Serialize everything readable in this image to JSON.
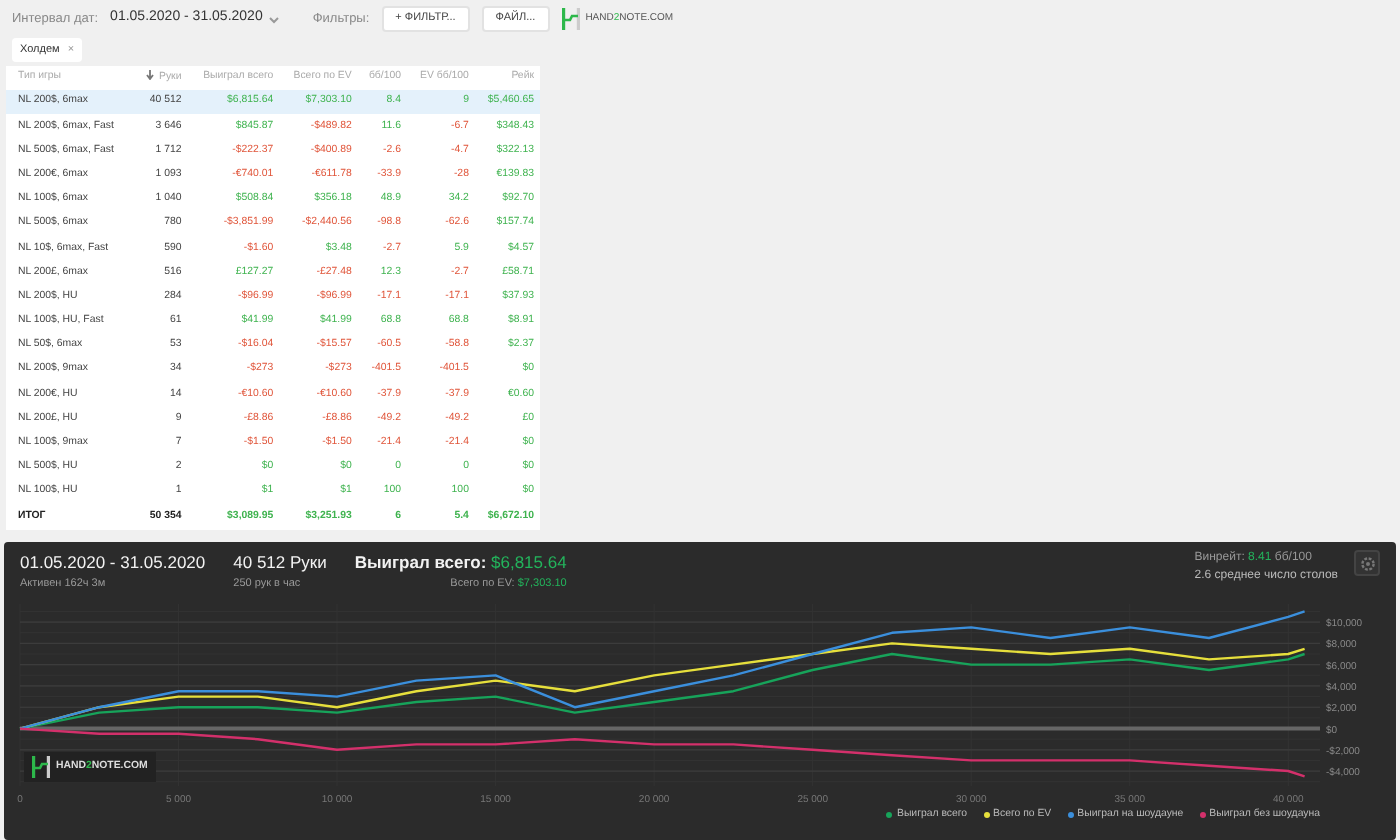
{
  "toolbar": {
    "date_label": "Интервал дат:",
    "date_value": "01.05.2020 - 31.05.2020",
    "filters_label": "Фильтры:",
    "filter_button": "+ ФИЛЬТР...",
    "file_button": "ФАЙЛ...",
    "logo": {
      "text_1": "HAND",
      "accent": "2",
      "text_2": "NOTE.COM"
    }
  },
  "chips": [
    {
      "label": "Холдем",
      "close": "×"
    }
  ],
  "table": {
    "columns": [
      {
        "label": "Тип игры",
        "sorted": false
      },
      {
        "label": "Руки",
        "sorted": true
      },
      {
        "label": "Выиграл всего",
        "sorted": false
      },
      {
        "label": "Всего по EV",
        "sorted": false
      },
      {
        "label": "бб/100",
        "sorted": false
      },
      {
        "label": "EV бб/100",
        "sorted": false
      },
      {
        "label": "Рейк",
        "sorted": false
      }
    ],
    "rows": [
      {
        "game": "NL 200$, 6max",
        "hands": "40 512",
        "values": [
          "$6,815.64",
          "$7,303.10",
          "8.4",
          "9",
          "$5,460.65"
        ],
        "loss": [
          false,
          false,
          false,
          false,
          false
        ],
        "selected": true
      },
      {
        "game": "NL 200$, 6max, Fast",
        "hands": "3 646",
        "values": [
          "$845.87",
          "-$489.82",
          "11.6",
          "-6.7",
          "$348.43"
        ],
        "loss": [
          false,
          true,
          false,
          true,
          false
        ],
        "selected": false
      },
      {
        "game": "NL 500$, 6max, Fast",
        "hands": "1 712",
        "values": [
          "-$222.37",
          "-$400.89",
          "-2.6",
          "-4.7",
          "$322.13"
        ],
        "loss": [
          true,
          true,
          true,
          true,
          false
        ],
        "selected": false
      },
      {
        "game": "NL 200€, 6max",
        "hands": "1 093",
        "values": [
          "-€740.01",
          "-€611.78",
          "-33.9",
          "-28",
          "€139.83"
        ],
        "loss": [
          true,
          true,
          true,
          true,
          false
        ],
        "selected": false
      },
      {
        "game": "NL 100$, 6max",
        "hands": "1 040",
        "values": [
          "$508.84",
          "$356.18",
          "48.9",
          "34.2",
          "$92.70"
        ],
        "loss": [
          false,
          false,
          false,
          false,
          false
        ],
        "selected": false
      },
      {
        "game": "NL 500$, 6max",
        "hands": "780",
        "values": [
          "-$3,851.99",
          "-$2,440.56",
          "-98.8",
          "-62.6",
          "$157.74"
        ],
        "loss": [
          true,
          true,
          true,
          true,
          false
        ],
        "selected": false
      },
      {
        "game": "NL 10$, 6max, Fast",
        "hands": "590",
        "values": [
          "-$1.60",
          "$3.48",
          "-2.7",
          "5.9",
          "$4.57"
        ],
        "loss": [
          true,
          false,
          true,
          false,
          false
        ],
        "selected": false
      },
      {
        "game": "NL 200£, 6max",
        "hands": "516",
        "values": [
          "£127.27",
          "-£27.48",
          "12.3",
          "-2.7",
          "£58.71"
        ],
        "loss": [
          false,
          true,
          false,
          true,
          false
        ],
        "selected": false
      },
      {
        "game": "NL 200$, HU",
        "hands": "284",
        "values": [
          "-$96.99",
          "-$96.99",
          "-17.1",
          "-17.1",
          "$37.93"
        ],
        "loss": [
          true,
          true,
          true,
          true,
          false
        ],
        "selected": false
      },
      {
        "game": "NL 100$, HU, Fast",
        "hands": "61",
        "values": [
          "$41.99",
          "$41.99",
          "68.8",
          "68.8",
          "$8.91"
        ],
        "loss": [
          false,
          false,
          false,
          false,
          false
        ],
        "selected": false
      },
      {
        "game": "NL 50$, 6max",
        "hands": "53",
        "values": [
          "-$16.04",
          "-$15.57",
          "-60.5",
          "-58.8",
          "$2.37"
        ],
        "loss": [
          true,
          true,
          true,
          true,
          false
        ],
        "selected": false
      },
      {
        "game": "NL 200$, 9max",
        "hands": "34",
        "values": [
          "-$273",
          "-$273",
          "-401.5",
          "-401.5",
          "$0"
        ],
        "loss": [
          true,
          true,
          true,
          true,
          false
        ],
        "selected": false
      },
      {
        "game": "NL 200€, HU",
        "hands": "14",
        "values": [
          "-€10.60",
          "-€10.60",
          "-37.9",
          "-37.9",
          "€0.60"
        ],
        "loss": [
          true,
          true,
          true,
          true,
          false
        ],
        "selected": false
      },
      {
        "game": "NL 200£, HU",
        "hands": "9",
        "values": [
          "-£8.86",
          "-£8.86",
          "-49.2",
          "-49.2",
          "£0"
        ],
        "loss": [
          true,
          true,
          true,
          true,
          false
        ],
        "selected": false
      },
      {
        "game": "NL 100$, 9max",
        "hands": "7",
        "values": [
          "-$1.50",
          "-$1.50",
          "-21.4",
          "-21.4",
          "$0"
        ],
        "loss": [
          true,
          true,
          true,
          true,
          false
        ],
        "selected": false
      },
      {
        "game": "NL 500$, HU",
        "hands": "2",
        "values": [
          "$0",
          "$0",
          "0",
          "0",
          "$0"
        ],
        "loss": [
          false,
          false,
          false,
          false,
          false
        ],
        "selected": false
      },
      {
        "game": "NL 100$, HU",
        "hands": "1",
        "values": [
          "$1",
          "$1",
          "100",
          "100",
          "$0"
        ],
        "loss": [
          false,
          false,
          false,
          false,
          false
        ],
        "selected": false
      }
    ],
    "total": {
      "game": "ИТОГ",
      "hands": "50 354",
      "values": [
        "$3,089.95",
        "$3,251.93",
        "6",
        "5.4",
        "$6,672.10"
      ],
      "loss": [
        false,
        false,
        false,
        false,
        false
      ]
    }
  },
  "graph_panel": {
    "period": "01.05.2020 - 31.05.2020",
    "active": "Активен 162ч 3м",
    "hands": "40 512 Руки",
    "hands_rate": "250 рук в час",
    "won_label": "Выиграл всего:",
    "won_value": "$6,815.64",
    "ev_label": "Всего по EV:",
    "ev_value": "$7,303.10",
    "winrate_label": "Винрейт:",
    "winrate_value": "8.41",
    "winrate_unit": "бб/100",
    "tables": "2.6 среднее число столов",
    "chart_logo": {
      "text_1": "HAND",
      "accent": "2",
      "text_2": "NOTE.COM"
    },
    "chart_data": {
      "type": "line",
      "grid": true,
      "x": [
        0,
        2500,
        5000,
        7500,
        10000,
        12500,
        15000,
        17500,
        20000,
        22500,
        25000,
        27500,
        30000,
        32500,
        35000,
        37500,
        40000,
        40512
      ],
      "xlim": [
        0,
        41000
      ],
      "ylim": [
        -5400,
        11700
      ],
      "xticks": [
        {
          "value": 0,
          "label": "0"
        },
        {
          "value": 5000,
          "label": "5 000"
        },
        {
          "value": 10000,
          "label": "10 000"
        },
        {
          "value": 15000,
          "label": "15 000"
        },
        {
          "value": 20000,
          "label": "20 000"
        },
        {
          "value": 25000,
          "label": "25 000"
        },
        {
          "value": 30000,
          "label": "30 000"
        },
        {
          "value": 35000,
          "label": "35 000"
        },
        {
          "value": 40000,
          "label": "40 000"
        }
      ],
      "yticks": [
        {
          "value": -4000,
          "label": "-$4,000"
        },
        {
          "value": -2000,
          "label": "-$2,000"
        },
        {
          "value": 0,
          "label": "$0"
        },
        {
          "value": 2000,
          "label": "$2,000"
        },
        {
          "value": 4000,
          "label": "$4,000"
        },
        {
          "value": 6000,
          "label": "$6,000"
        },
        {
          "value": 8000,
          "label": "$8,000"
        },
        {
          "value": 10000,
          "label": "$10,000"
        }
      ],
      "series": [
        {
          "name": "Выиграл всего",
          "color": "#17a35a",
          "values": [
            0,
            1500,
            2000,
            2000,
            1500,
            2500,
            3000,
            1500,
            2500,
            3500,
            5500,
            7000,
            6000,
            6000,
            6500,
            5500,
            6500,
            7000
          ]
        },
        {
          "name": "Всего по EV",
          "color": "#e6df3c",
          "values": [
            0,
            2000,
            3000,
            3000,
            2000,
            3500,
            4500,
            3500,
            5000,
            6000,
            7000,
            8000,
            7500,
            7000,
            7500,
            6500,
            7000,
            7500
          ]
        },
        {
          "name": "Выиграл на шоудауне",
          "color": "#3b8fdc",
          "values": [
            0,
            2000,
            3500,
            3500,
            3000,
            4500,
            5000,
            2000,
            3500,
            5000,
            7000,
            9000,
            9500,
            8500,
            9500,
            8500,
            10500,
            11000
          ]
        },
        {
          "name": "Выиграл без шоудауна",
          "color": "#d3306b",
          "values": [
            0,
            -500,
            -500,
            -1000,
            -2000,
            -1500,
            -1500,
            -1000,
            -1500,
            -1500,
            -2000,
            -2500,
            -3000,
            -3000,
            -3000,
            -3500,
            -4000,
            -4500
          ]
        }
      ]
    }
  }
}
